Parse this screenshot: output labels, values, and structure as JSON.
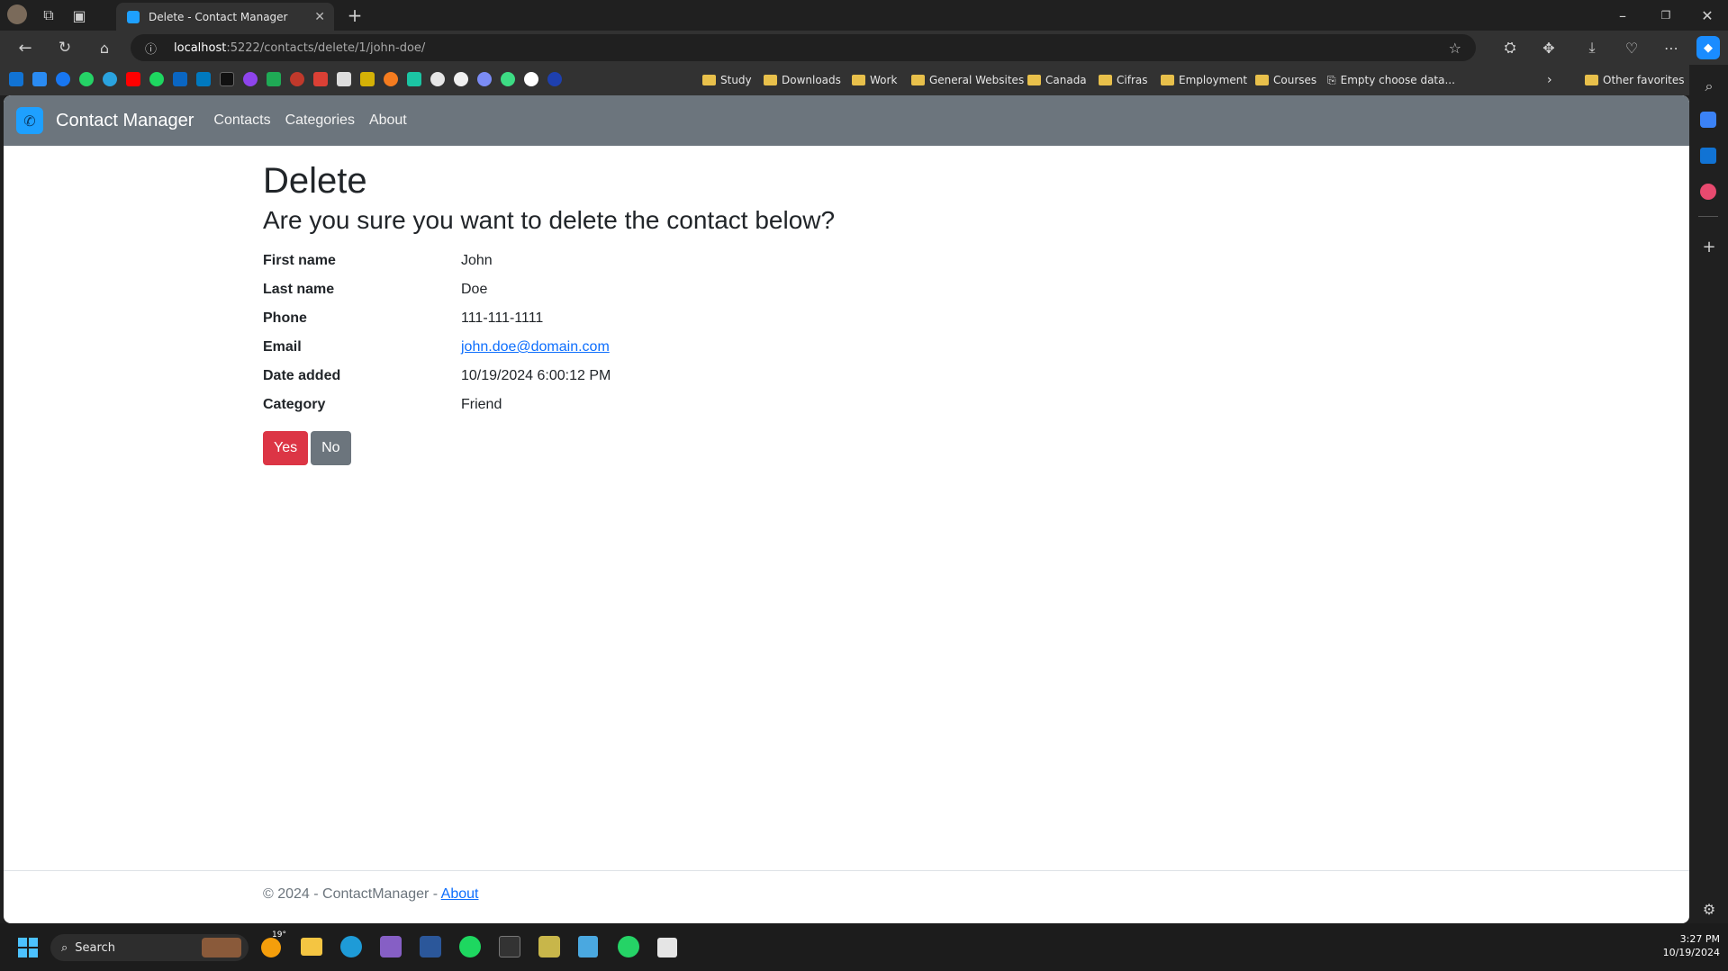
{
  "browser": {
    "tab_title": "Delete - Contact Manager",
    "url_host": "localhost",
    "url_rest": ":5222/contacts/delete/1/john-doe/",
    "bookmarks": [
      "Study",
      "Downloads",
      "Work",
      "General Websites",
      "Canada",
      "Cifras",
      "Employment",
      "Courses",
      "Empty choose data..."
    ],
    "other_favorites": "Other favorites"
  },
  "app": {
    "brand": "Contact Manager",
    "nav": [
      "Contacts",
      "Categories",
      "About"
    ]
  },
  "page": {
    "title": "Delete",
    "question": "Are you sure you want to delete the contact below?",
    "fields": [
      {
        "label": "First name",
        "value": "John"
      },
      {
        "label": "Last name",
        "value": "Doe"
      },
      {
        "label": "Phone",
        "value": "111-111-1111"
      },
      {
        "label": "Email",
        "value": "john.doe@domain.com"
      },
      {
        "label": "Date added",
        "value": "10/19/2024 6:00:12 PM"
      },
      {
        "label": "Category",
        "value": "Friend"
      }
    ],
    "yes_label": "Yes",
    "no_label": "No"
  },
  "footer": {
    "text": "© 2024 - ContactManager - ",
    "about_link": "About"
  },
  "taskbar": {
    "search_label": "Search",
    "weather": "19°",
    "time": "3:27 PM",
    "date": "10/19/2024"
  },
  "colors": {
    "navbar": "#6c757d",
    "danger": "#dc3545",
    "secondary": "#6c757d",
    "link": "#0d6efd"
  }
}
